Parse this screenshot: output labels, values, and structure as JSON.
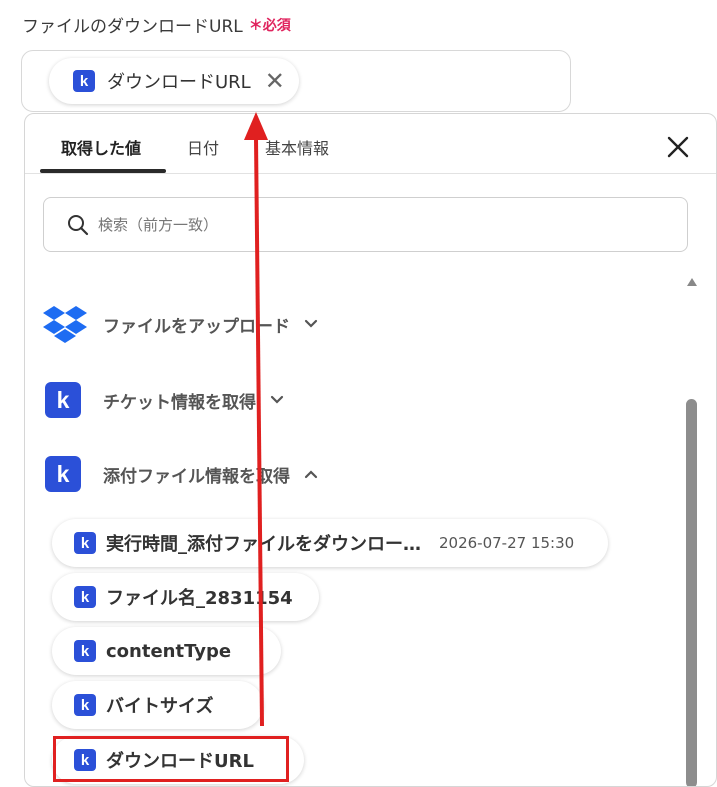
{
  "field": {
    "label": "ファイルのダウンロードURL",
    "required_mark": "＊",
    "required_text": "必須",
    "chip_label": "ダウンロードURL",
    "chip_icon": "k",
    "remove_symbol": "✕"
  },
  "tabs": [
    {
      "label": "取得した値",
      "active": true
    },
    {
      "label": "日付",
      "active": false
    },
    {
      "label": "基本情報",
      "active": false
    }
  ],
  "search": {
    "placeholder": "検索（前方一致）"
  },
  "sections": [
    {
      "label": "ファイルをアップロード",
      "icon": "dropbox-icon",
      "expanded": false
    },
    {
      "label": "チケット情報を取得",
      "icon": "k",
      "expanded": false
    },
    {
      "label": "添付ファイル情報を取得",
      "icon": "k",
      "expanded": true
    }
  ],
  "items": [
    {
      "label": "実行時間_添付ファイルをダウンロー…",
      "value": "2026-07-27 15:30",
      "icon": "k"
    },
    {
      "label": "ファイル名_2831154",
      "icon": "k"
    },
    {
      "label": "contentType",
      "icon": "k"
    },
    {
      "label": "バイトサイズ",
      "icon": "k"
    },
    {
      "label": "ダウンロードURL",
      "icon": "k"
    }
  ],
  "colors": {
    "brand": "#2b50d8",
    "required": "#e0245e",
    "annotation": "#e02020",
    "dropbox": "#1e6cf2"
  }
}
